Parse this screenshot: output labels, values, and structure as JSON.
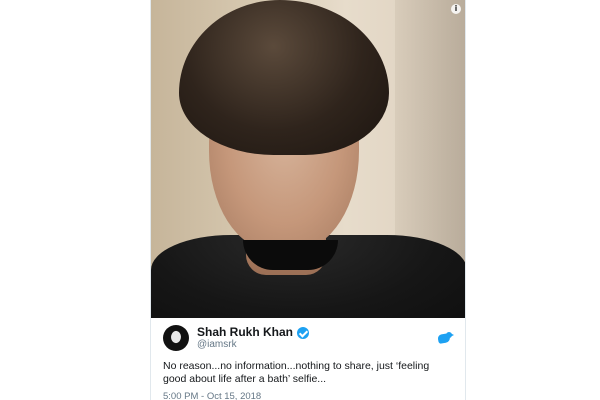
{
  "tweet": {
    "display_name": "Shah Rukh Khan",
    "handle": "@iamsrk",
    "text": "No reason...no information...nothing to share, just ‘feeling good about life after a bath’ selfie...",
    "timestamp": "5:00 PM - Oct 15, 2018",
    "verified": true
  },
  "icons": {
    "info": "info-icon",
    "verified": "verified-icon",
    "brand": "twitter-icon"
  },
  "colors": {
    "accent": "#1da1f2",
    "text": "#14171a",
    "muted": "#657786"
  },
  "info_glyph": "i"
}
